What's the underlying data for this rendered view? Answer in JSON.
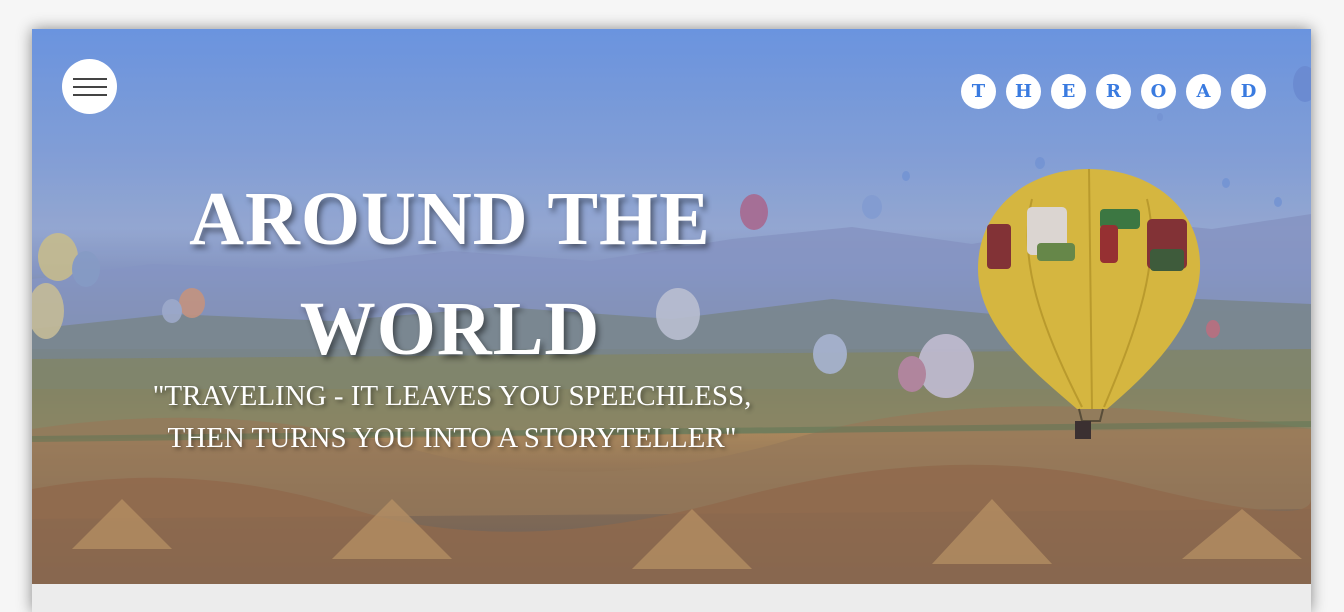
{
  "header": {
    "menu_icon": "hamburger-menu-icon",
    "logo_letters": [
      "T",
      "H",
      "E",
      "R",
      "O",
      "A",
      "D"
    ]
  },
  "hero": {
    "title": "AROUND THE WORLD",
    "quote": "\"TRAVELING - IT LEAVES YOU SPEECHLESS, THEN TURNS YOU INTO A STORYTELLER\""
  },
  "colors": {
    "logo_text": "#3a7be0",
    "sky": "#6f9be6",
    "balloon": "#e9c232"
  }
}
